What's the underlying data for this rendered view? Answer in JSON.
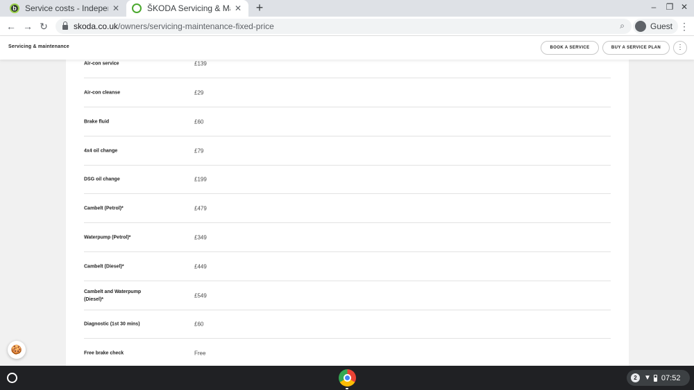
{
  "browser": {
    "tabs": [
      {
        "title": "Service costs - Independant v De",
        "active": false
      },
      {
        "title": "ŠKODA Servicing & Maintenance",
        "active": true
      }
    ],
    "new_tab_label": "+",
    "url_domain": "skoda.co.uk",
    "url_path": "/owners/servicing-maintenance-fixed-price",
    "profile_label": "Guest"
  },
  "site_header": {
    "section_title": "Servicing & maintenance",
    "book_service_label": "BOOK A SERVICE",
    "buy_plan_label": "BUY A SERVICE PLAN"
  },
  "prices": [
    {
      "service": "Air-con service",
      "price": "£139"
    },
    {
      "service": "Air-con cleanse",
      "price": "£29"
    },
    {
      "service": "Brake fluid",
      "price": "£60"
    },
    {
      "service": "4x4 oil change",
      "price": "£79"
    },
    {
      "service": "DSG oil change",
      "price": "£199"
    },
    {
      "service": "Cambelt (Petrol)*",
      "price": "£479"
    },
    {
      "service": "Waterpump (Petrol)*",
      "price": "£349"
    },
    {
      "service": "Cambelt (Diesel)*",
      "price": "£449"
    },
    {
      "service": "Cambelt and Waterpump (Diesel)*",
      "price": "£549"
    },
    {
      "service": "Diagnostic (1st 30 mins)",
      "price": "£60"
    },
    {
      "service": "Free brake check",
      "price": "Free"
    }
  ],
  "shelf": {
    "notification_count": "2",
    "time": "07:52"
  },
  "icons": {
    "cookie": "cookie-icon",
    "launcher": "launcher-icon",
    "chrome": "chrome-app-icon"
  },
  "colors": {
    "skoda_green": "#4ba82e",
    "tab_strip": "#dee1e6",
    "shelf": "#202124"
  }
}
